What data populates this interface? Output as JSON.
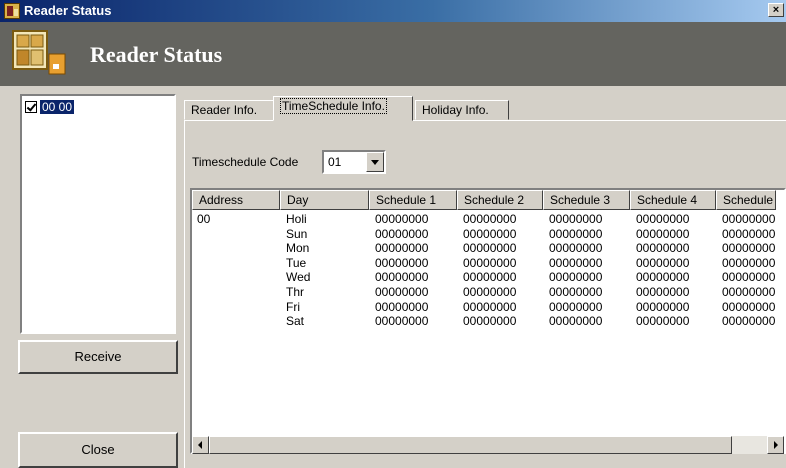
{
  "window": {
    "title": "Reader Status",
    "close_glyph": "×"
  },
  "header": {
    "title": "Reader Status",
    "icon": "reader-status-icon"
  },
  "reader_list": {
    "items": [
      {
        "label": "00 00",
        "checked": true
      }
    ]
  },
  "buttons": {
    "receive": "Receive",
    "close": "Close"
  },
  "tabs": [
    {
      "label": "Reader Info."
    },
    {
      "label": "TimeSchedule Info.",
      "active": true
    },
    {
      "label": "Holiday Info."
    }
  ],
  "timeschedule": {
    "label": "Timeschedule Code",
    "value": "01"
  },
  "grid": {
    "columns": [
      "Address",
      "Day",
      "Schedule 1",
      "Schedule 2",
      "Schedule 3",
      "Schedule 4",
      "Schedule"
    ],
    "address": "00",
    "days": [
      "Holi",
      "Sun",
      "Mon",
      "Tue",
      "Wed",
      "Thr",
      "Fri",
      "Sat"
    ],
    "schedule_value": "00000000"
  },
  "colors": {
    "title_bar": "#0a246a",
    "header_bg": "#64645f",
    "face": "#d4d0c8",
    "selection": "#0a246a"
  }
}
